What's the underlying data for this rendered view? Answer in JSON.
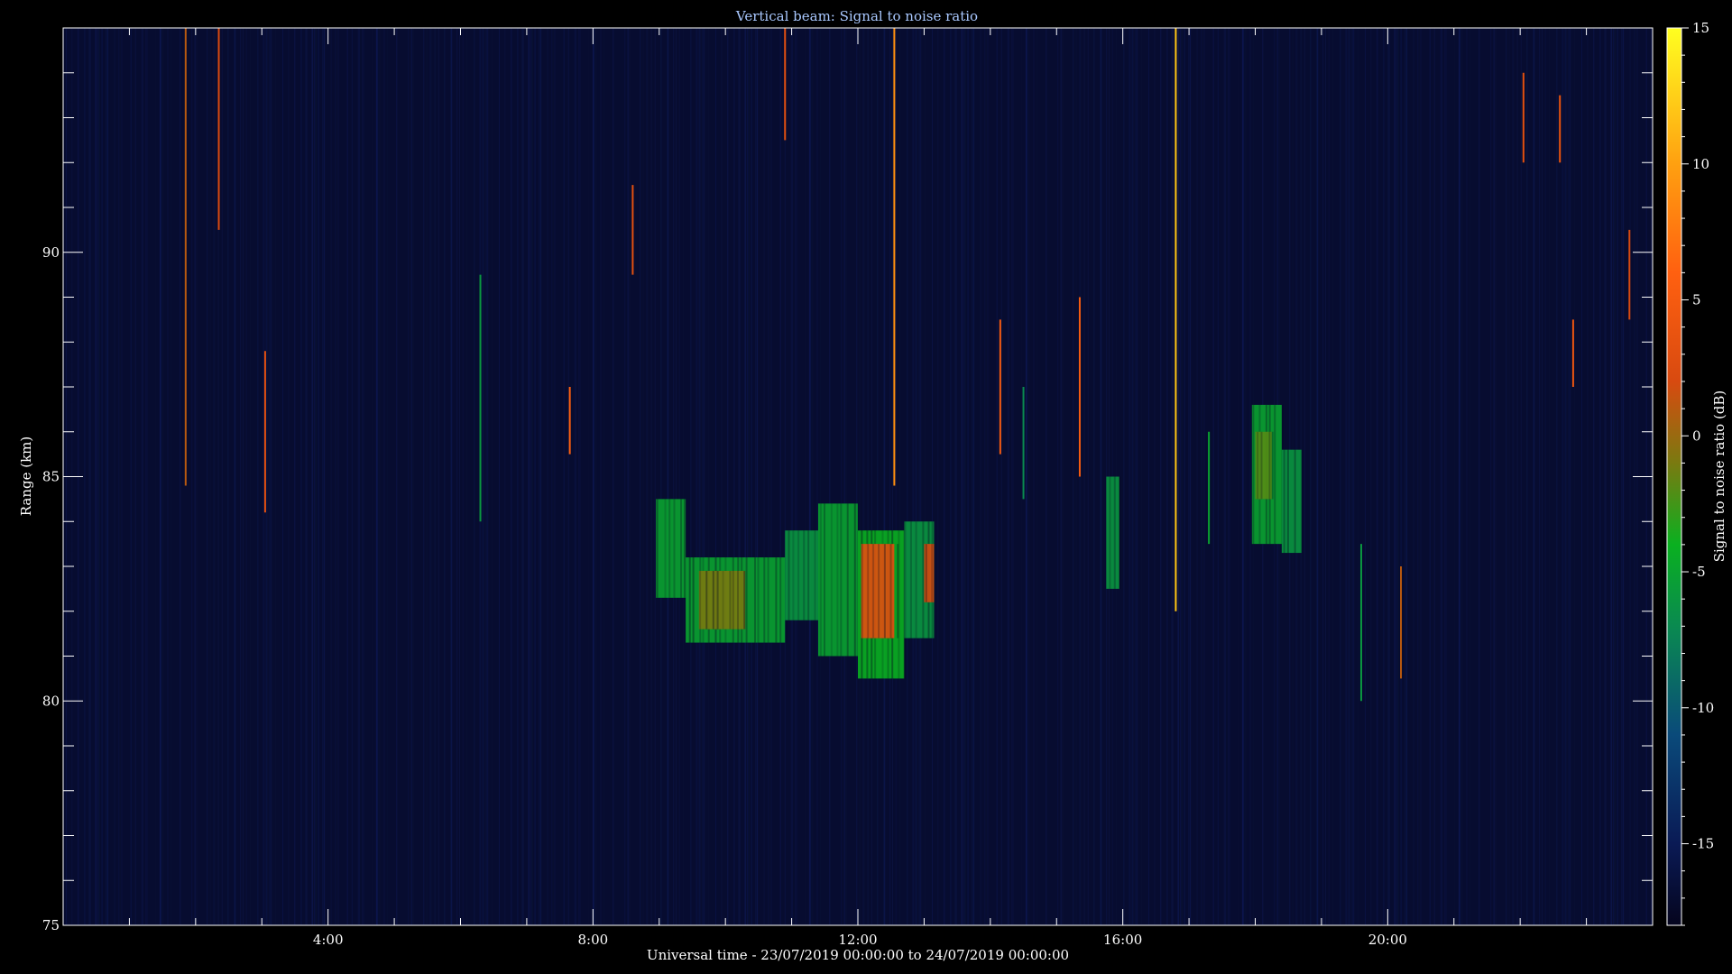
{
  "chart_data": {
    "type": "heatmap",
    "title": "Vertical beam: Signal to noise ratio",
    "xlabel": "Universal time - 23/07/2019 00:00:00 to 24/07/2019 00:00:00",
    "ylabel": "Range (km)",
    "colorbar_label": "Signal to noise ratio (dB)",
    "x_unit": "hours UT",
    "xlim": [
      0,
      24
    ],
    "ylim": [
      75,
      95
    ],
    "x_ticks": [
      {
        "value": 4,
        "label": "4:00"
      },
      {
        "value": 8,
        "label": "8:00"
      },
      {
        "value": 12,
        "label": "12:00"
      },
      {
        "value": 16,
        "label": "16:00"
      },
      {
        "value": 20,
        "label": "20:00"
      }
    ],
    "y_ticks": [
      {
        "value": 75,
        "label": "75"
      },
      {
        "value": 80,
        "label": "80"
      },
      {
        "value": 85,
        "label": "85"
      },
      {
        "value": 90,
        "label": "90"
      }
    ],
    "colorbar": {
      "range": [
        -18,
        15
      ],
      "ticks": [
        {
          "value": 15,
          "label": "15"
        },
        {
          "value": 10,
          "label": "10"
        },
        {
          "value": 5,
          "label": "5"
        },
        {
          "value": 0,
          "label": "0"
        },
        {
          "value": -5,
          "label": "-5"
        },
        {
          "value": -10,
          "label": "-10"
        },
        {
          "value": -15,
          "label": "-15"
        }
      ],
      "colors": [
        {
          "value": -18,
          "color": "#05051e"
        },
        {
          "value": -15,
          "color": "#0a1a55"
        },
        {
          "value": -11,
          "color": "#0a4a7a"
        },
        {
          "value": -7,
          "color": "#0a8a50"
        },
        {
          "value": -4,
          "color": "#0ab020"
        },
        {
          "value": -1,
          "color": "#7a7a10"
        },
        {
          "value": 2,
          "color": "#d84a10"
        },
        {
          "value": 6,
          "color": "#ff6010"
        },
        {
          "value": 10,
          "color": "#ffa010"
        },
        {
          "value": 15,
          "color": "#ffff20"
        }
      ]
    },
    "background_snr_db": -17,
    "echo_regions": [
      {
        "x": [
          8.95,
          9.4
        ],
        "y": [
          82.3,
          84.5
        ],
        "snr_db": -5
      },
      {
        "x": [
          9.4,
          10.9
        ],
        "y": [
          81.3,
          83.2
        ],
        "snr_db": -5
      },
      {
        "x": [
          9.6,
          10.3
        ],
        "y": [
          81.6,
          82.9
        ],
        "snr_db": -1
      },
      {
        "x": [
          10.9,
          11.4
        ],
        "y": [
          81.8,
          83.8
        ],
        "snr_db": -6
      },
      {
        "x": [
          11.4,
          12.0
        ],
        "y": [
          81.0,
          84.4
        ],
        "snr_db": -5
      },
      {
        "x": [
          12.0,
          12.7
        ],
        "y": [
          80.5,
          83.8
        ],
        "snr_db": -4
      },
      {
        "x": [
          12.7,
          13.15
        ],
        "y": [
          81.4,
          84.0
        ],
        "snr_db": -6
      },
      {
        "x": [
          12.05,
          12.55
        ],
        "y": [
          81.4,
          83.5
        ],
        "snr_db": 3
      },
      {
        "x": [
          13.0,
          13.15
        ],
        "y": [
          82.2,
          83.5
        ],
        "snr_db": 2
      },
      {
        "x": [
          15.75,
          15.95
        ],
        "y": [
          82.5,
          85.0
        ],
        "snr_db": -6
      },
      {
        "x": [
          17.95,
          18.4
        ],
        "y": [
          83.5,
          86.6
        ],
        "snr_db": -5
      },
      {
        "x": [
          18.0,
          18.25
        ],
        "y": [
          84.5,
          86.0
        ],
        "snr_db": -2
      },
      {
        "x": [
          18.4,
          18.7
        ],
        "y": [
          83.3,
          85.6
        ],
        "snr_db": -6
      }
    ],
    "spikes": [
      {
        "x": 1.85,
        "y": [
          84.8,
          95.0
        ],
        "snr_db": 1
      },
      {
        "x": 2.35,
        "y": [
          90.5,
          95.0
        ],
        "snr_db": 2
      },
      {
        "x": 3.05,
        "y": [
          84.2,
          87.8
        ],
        "snr_db": 3
      },
      {
        "x": 6.3,
        "y": [
          84.0,
          89.5
        ],
        "snr_db": -6
      },
      {
        "x": 7.65,
        "y": [
          85.5,
          87.0
        ],
        "snr_db": 6
      },
      {
        "x": 8.6,
        "y": [
          89.5,
          91.5
        ],
        "snr_db": 3
      },
      {
        "x": 10.9,
        "y": [
          92.5,
          95.0
        ],
        "snr_db": 3
      },
      {
        "x": 12.55,
        "y": [
          84.8,
          95.0
        ],
        "snr_db": 9
      },
      {
        "x": 14.15,
        "y": [
          85.5,
          88.5
        ],
        "snr_db": 5
      },
      {
        "x": 14.5,
        "y": [
          84.5,
          87.0
        ],
        "snr_db": -7
      },
      {
        "x": 15.35,
        "y": [
          85.0,
          89.0
        ],
        "snr_db": 5
      },
      {
        "x": 16.8,
        "y": [
          82.0,
          95.0
        ],
        "snr_db": 12
      },
      {
        "x": 17.3,
        "y": [
          83.5,
          86.0
        ],
        "snr_db": -5
      },
      {
        "x": 19.6,
        "y": [
          80.0,
          83.5
        ],
        "snr_db": -6
      },
      {
        "x": 20.2,
        "y": [
          80.5,
          83.0
        ],
        "snr_db": 1
      },
      {
        "x": 22.05,
        "y": [
          92.0,
          94.0
        ],
        "snr_db": 3
      },
      {
        "x": 22.6,
        "y": [
          92.0,
          93.5
        ],
        "snr_db": 4
      },
      {
        "x": 22.8,
        "y": [
          87.0,
          88.5
        ],
        "snr_db": 4
      },
      {
        "x": 23.65,
        "y": [
          88.5,
          90.5
        ],
        "snr_db": 2
      }
    ]
  }
}
